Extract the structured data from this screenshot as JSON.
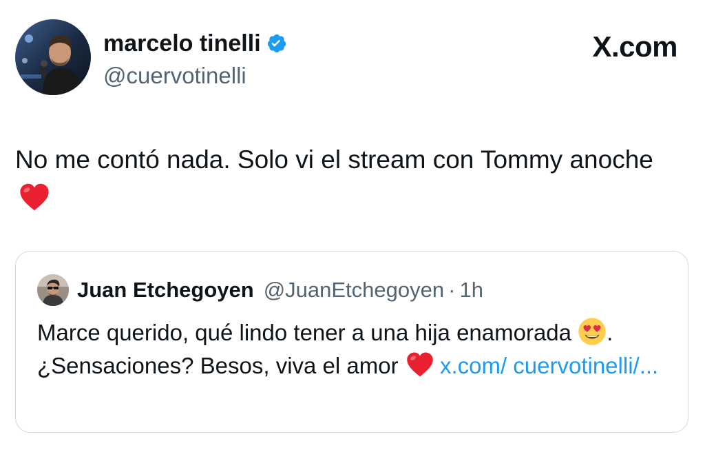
{
  "author": {
    "name": "marcelo tinelli",
    "handle": "@cuervotinelli",
    "verified": true,
    "avatar_icon": "user-photo"
  },
  "site_label": "X.com",
  "tweet": {
    "text": "No me contó nada. Solo vi el stream con Tommy anoche",
    "trailing_emoji": "red-heart"
  },
  "quoted_tweet": {
    "name": "Juan Etchegoyen",
    "handle": "@JuanEtchegoyen",
    "separator": "·",
    "time": "1h",
    "text_part1": "Marce querido, qué lindo tener a una hija enamorada",
    "emoji_1": "heart-eyes",
    "text_part2": ". ¿Sensaciones? Besos, viva el amor",
    "emoji_2": "red-heart",
    "link_text": "x.com/ cuervotinelli/..."
  },
  "colors": {
    "text_primary": "#0f1419",
    "text_secondary": "#536471",
    "link": "#1d9bf0",
    "verified": "#1d9bf0",
    "border": "#cfd9de",
    "heart": "#e8202f"
  }
}
